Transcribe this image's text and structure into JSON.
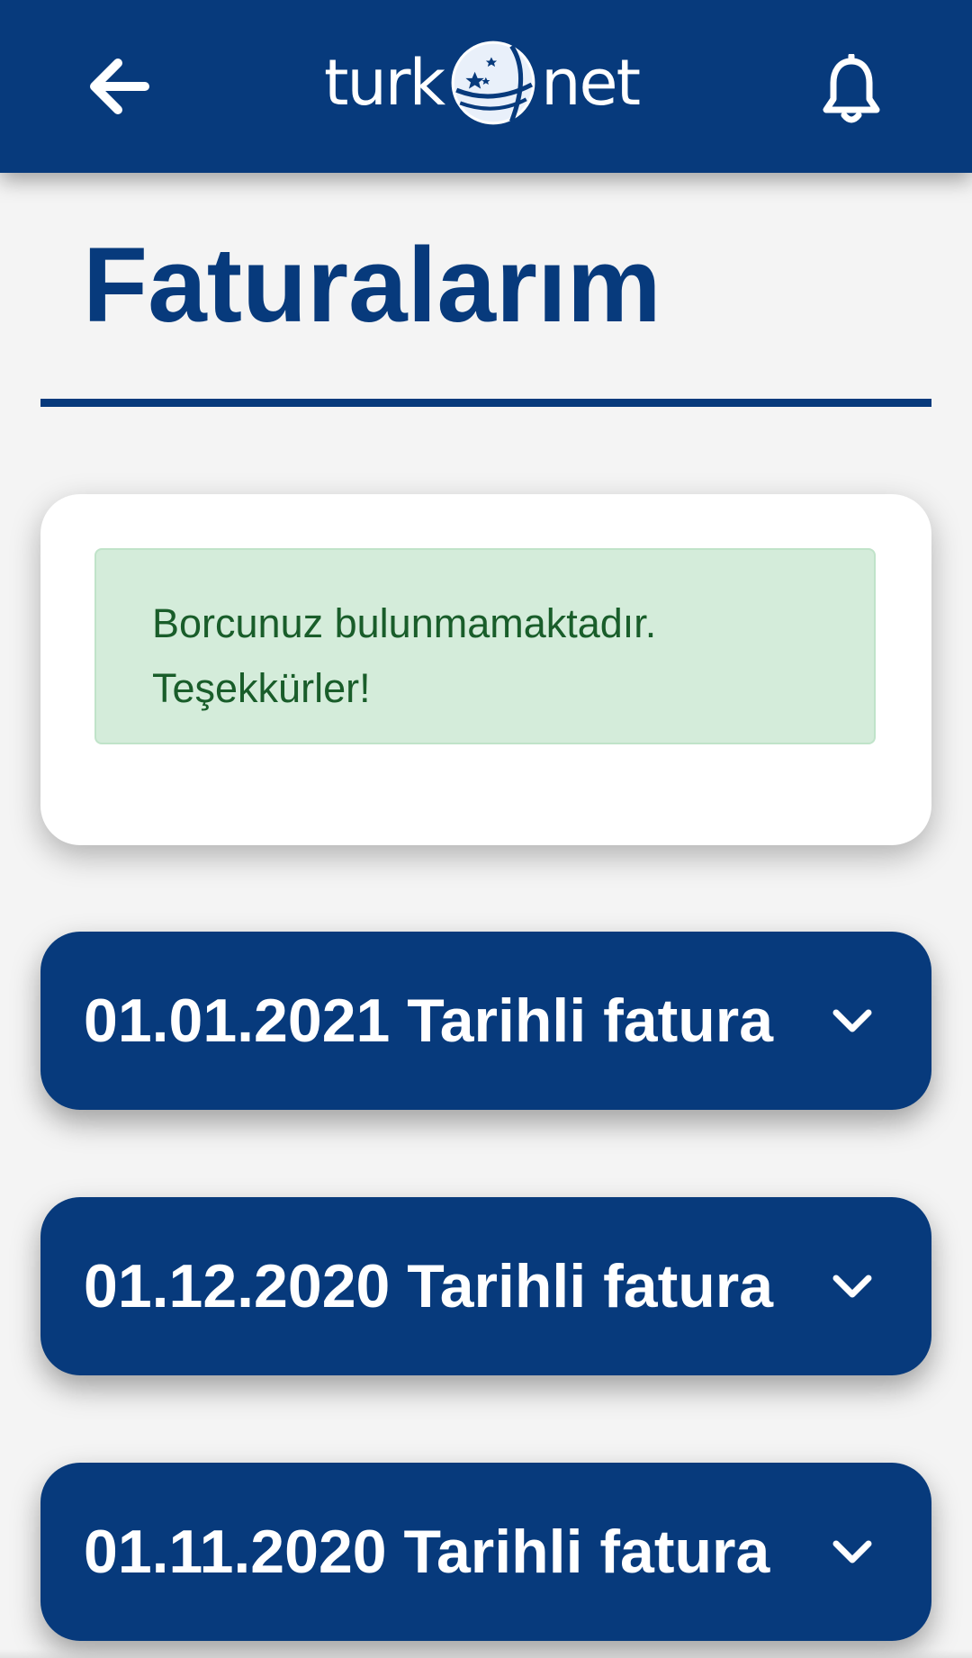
{
  "header": {
    "logo_left": "turk",
    "logo_right": "net",
    "back_icon": "arrow-left-icon",
    "bell_icon": "bell-icon"
  },
  "page": {
    "title": "Faturalarım"
  },
  "notice": {
    "line1": "Borcunuz bulunmamaktadır.",
    "line2": "Teşekkürler!"
  },
  "invoices": [
    {
      "label": "01.01.2021 Tarihli fatura"
    },
    {
      "label": "01.12.2020 Tarihli fatura"
    },
    {
      "label": "01.11.2020 Tarihli fatura"
    }
  ],
  "colors": {
    "brand": "#073a7c",
    "background": "#f4f4f4",
    "success_bg": "#d4ecda",
    "success_text": "#195d2a"
  }
}
